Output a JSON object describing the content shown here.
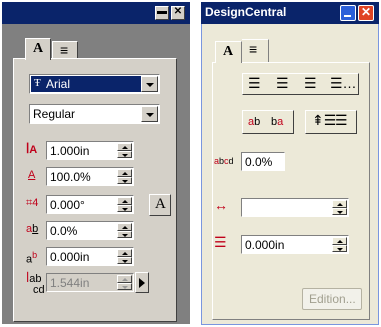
{
  "left_panel": {
    "tabs": [
      "A",
      "≡"
    ],
    "font_name": "Arial",
    "font_style": "Regular",
    "rows": [
      {
        "icon": "height-icon",
        "value": "1.000in"
      },
      {
        "icon": "width-factor-icon",
        "value": "100.0%"
      },
      {
        "icon": "oblique-angle-icon",
        "value": "0.000°"
      },
      {
        "icon": "tracking-icon",
        "value": "0.0%"
      },
      {
        "icon": "baseline-shift-icon",
        "value": "0.000in"
      },
      {
        "icon": "line-spacing-icon",
        "value": "1.544in"
      }
    ],
    "side_button_label": "A"
  },
  "right_panel": {
    "title": "DesignCentral",
    "tabs": [
      "A",
      "≡"
    ],
    "tracking_value": "0.0%",
    "width_value": "",
    "spacing_value": "0.000in",
    "edition_label": "Edition..."
  },
  "colors": {
    "title_bar": "#0a246a",
    "xp_title": "#0a246a",
    "window_bg": "#d4d0c8",
    "xp_bg": "#ece9d8",
    "selection": "#0a246a",
    "close_red": "#e04424",
    "icon_red": "#c0001a"
  }
}
